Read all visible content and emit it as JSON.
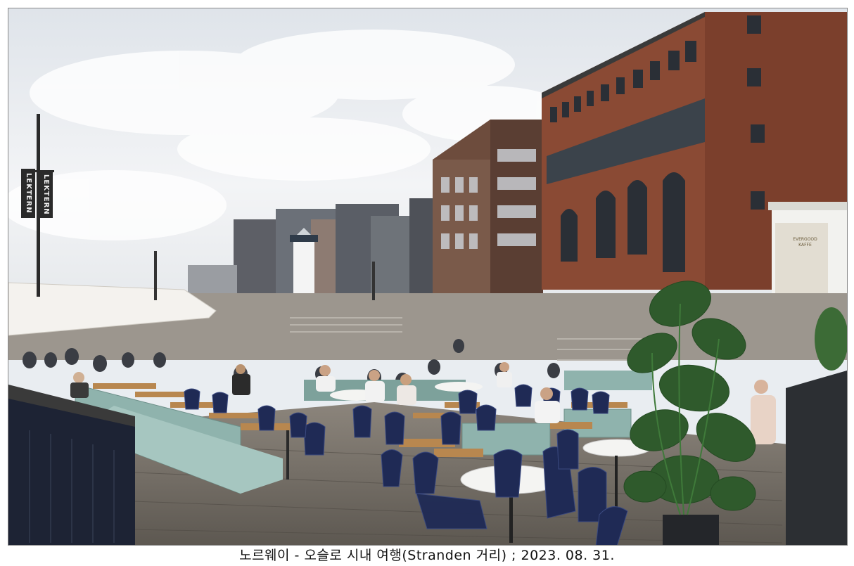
{
  "photo": {
    "caption": "노르웨이 - 오슬로 시내 여행(Stranden 거리) ; 2023. 08. 31.",
    "signs": [
      "LEKTERN",
      "LEKTERN"
    ],
    "poster_text": [
      "EVERGOOD",
      "KAFFE"
    ]
  },
  "colors": {
    "sky": "#eef1f4",
    "brick": "#8a4a34",
    "deck": "#6f6a63",
    "chair_navy": "#1f2a55",
    "bench_teal": "#8fb3ad",
    "monstera": "#2f5a2c"
  }
}
